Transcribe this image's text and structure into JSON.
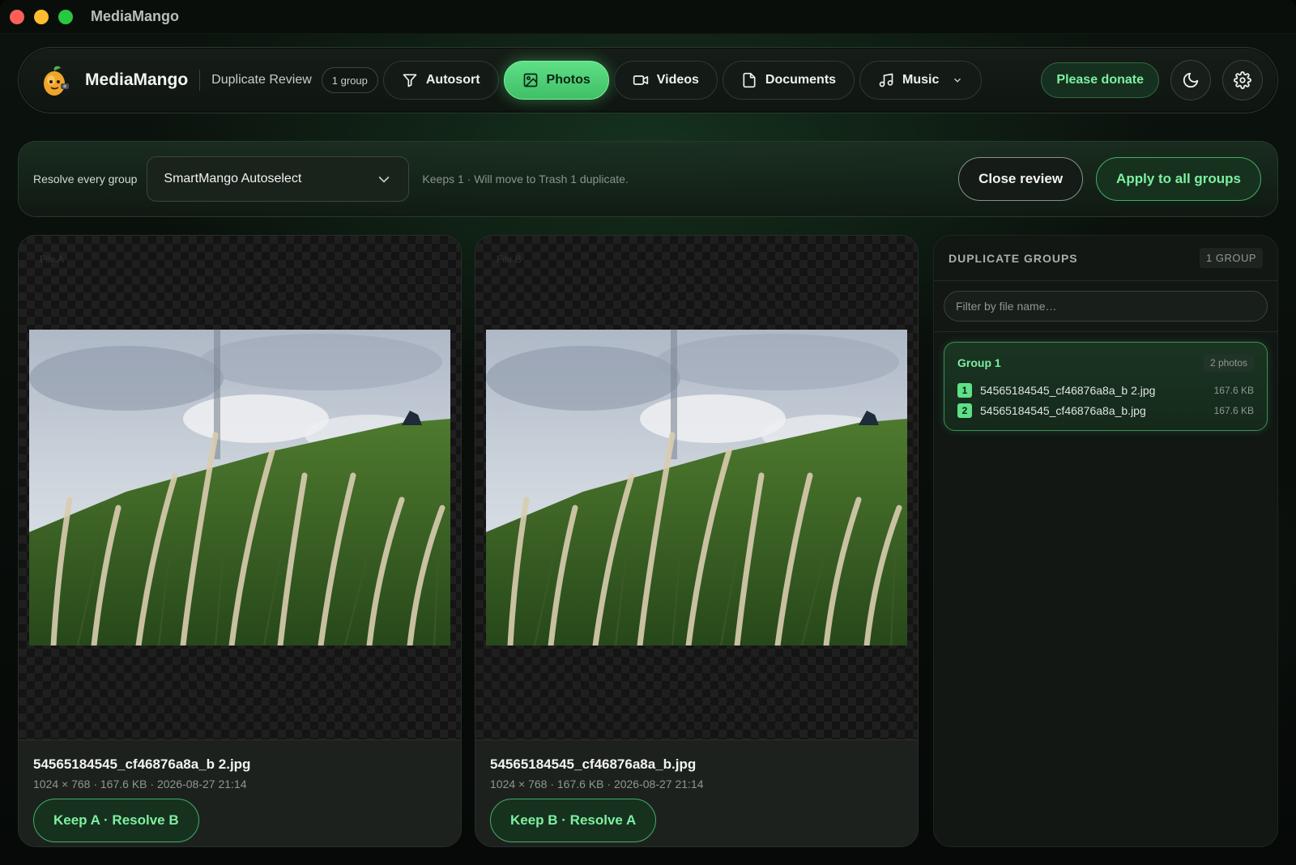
{
  "window": {
    "title": "MediaMango"
  },
  "header": {
    "brand": "MediaMango",
    "section": "Duplicate Review",
    "group_badge": "1 group",
    "nav": [
      {
        "label": "Autosort",
        "icon": "filter-icon",
        "active": false
      },
      {
        "label": "Photos",
        "icon": "image-icon",
        "active": true
      },
      {
        "label": "Videos",
        "icon": "video-icon",
        "active": false
      },
      {
        "label": "Documents",
        "icon": "document-icon",
        "active": false
      },
      {
        "label": "Music",
        "icon": "music-icon",
        "active": false
      }
    ],
    "donate_label": "Please donate",
    "theme_icon": "moon-icon",
    "settings_icon": "gear-icon"
  },
  "resolve_bar": {
    "label": "Resolve every group",
    "strategy": "SmartMango Autoselect",
    "hint": "Keeps 1 · Will move to Trash 1 duplicate.",
    "close_label": "Close review",
    "apply_label": "Apply to all groups"
  },
  "file_a": {
    "tag": "File A",
    "name": "54565184545_cf46876a8a_b 2.jpg",
    "meta": "1024 × 768 · 167.6 KB · 2026-08-27 21:14",
    "action": "Keep A · Resolve B"
  },
  "file_b": {
    "tag": "File B",
    "name": "54565184545_cf46876a8a_b.jpg",
    "meta": "1024 × 768 · 167.6 KB · 2026-08-27 21:14",
    "action": "Keep B · Resolve A"
  },
  "sidebar": {
    "title": "DUPLICATE GROUPS",
    "count": "1 GROUP",
    "filter_placeholder": "Filter by file name…",
    "groups": [
      {
        "title": "Group 1",
        "count": "2 photos",
        "files": [
          {
            "index": "1",
            "name": "54565184545_cf46876a8a_b 2.jpg",
            "size": "167.6 KB"
          },
          {
            "index": "2",
            "name": "54565184545_cf46876a8a_b.jpg",
            "size": "167.6 KB"
          }
        ]
      }
    ]
  },
  "colors": {
    "accent": "#5fdf86",
    "accent_text": "#7ef0a0",
    "background": "#060907"
  }
}
